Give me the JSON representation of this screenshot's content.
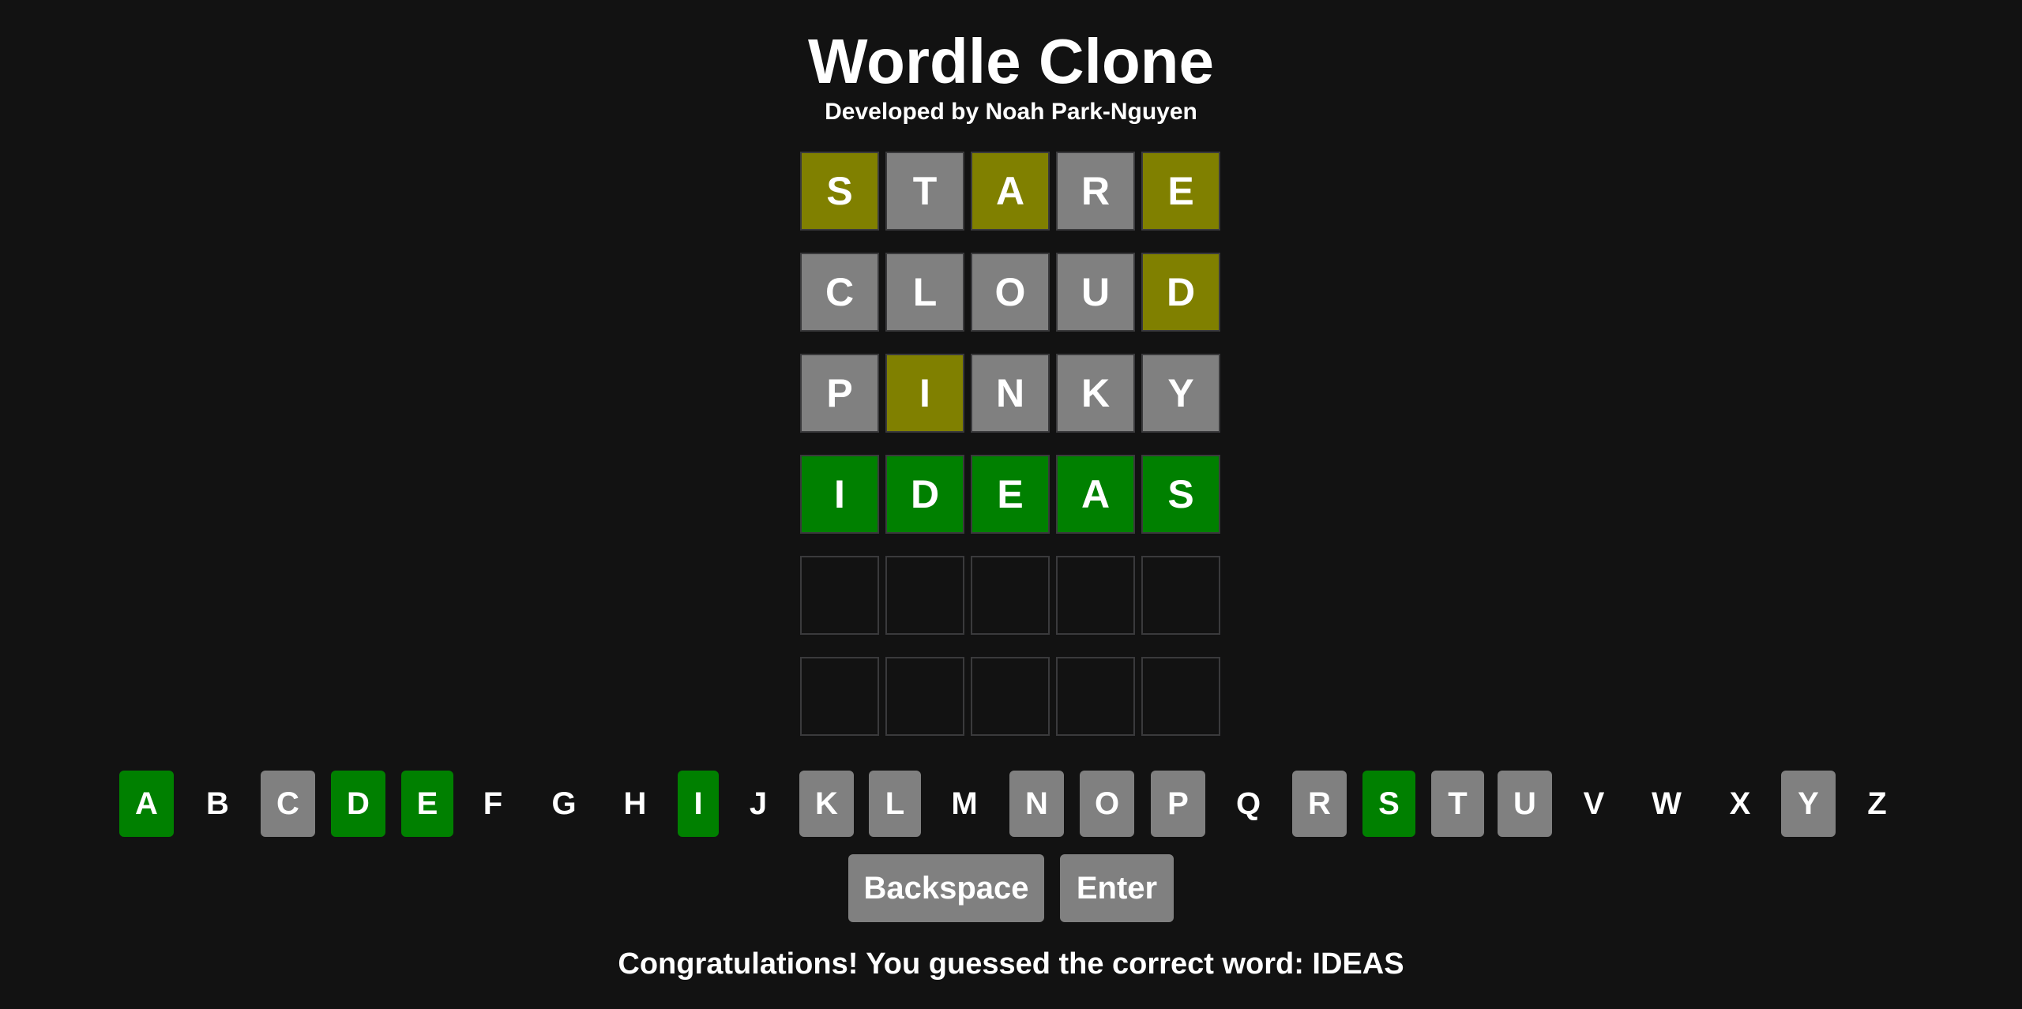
{
  "header": {
    "title": "Wordle Clone",
    "subtitle": "Developed by Noah Park-Nguyen"
  },
  "colors": {
    "background": "#121212",
    "correct": "#008000",
    "present": "#808000",
    "absent": "#808080",
    "empty_border": "#3a3a3c"
  },
  "board": {
    "rows": [
      [
        {
          "letter": "S",
          "state": "present"
        },
        {
          "letter": "T",
          "state": "absent"
        },
        {
          "letter": "A",
          "state": "present"
        },
        {
          "letter": "R",
          "state": "absent"
        },
        {
          "letter": "E",
          "state": "present"
        }
      ],
      [
        {
          "letter": "C",
          "state": "absent"
        },
        {
          "letter": "L",
          "state": "absent"
        },
        {
          "letter": "O",
          "state": "absent"
        },
        {
          "letter": "U",
          "state": "absent"
        },
        {
          "letter": "D",
          "state": "present"
        }
      ],
      [
        {
          "letter": "P",
          "state": "absent"
        },
        {
          "letter": "I",
          "state": "present"
        },
        {
          "letter": "N",
          "state": "absent"
        },
        {
          "letter": "K",
          "state": "absent"
        },
        {
          "letter": "Y",
          "state": "absent"
        }
      ],
      [
        {
          "letter": "I",
          "state": "correct"
        },
        {
          "letter": "D",
          "state": "correct"
        },
        {
          "letter": "E",
          "state": "correct"
        },
        {
          "letter": "A",
          "state": "correct"
        },
        {
          "letter": "S",
          "state": "correct"
        }
      ],
      [
        {
          "letter": "",
          "state": "empty"
        },
        {
          "letter": "",
          "state": "empty"
        },
        {
          "letter": "",
          "state": "empty"
        },
        {
          "letter": "",
          "state": "empty"
        },
        {
          "letter": "",
          "state": "empty"
        }
      ],
      [
        {
          "letter": "",
          "state": "empty"
        },
        {
          "letter": "",
          "state": "empty"
        },
        {
          "letter": "",
          "state": "empty"
        },
        {
          "letter": "",
          "state": "empty"
        },
        {
          "letter": "",
          "state": "empty"
        }
      ]
    ]
  },
  "keyboard": {
    "keys": [
      {
        "letter": "A",
        "state": "correct"
      },
      {
        "letter": "B",
        "state": "unused"
      },
      {
        "letter": "C",
        "state": "absent"
      },
      {
        "letter": "D",
        "state": "correct"
      },
      {
        "letter": "E",
        "state": "correct"
      },
      {
        "letter": "F",
        "state": "unused"
      },
      {
        "letter": "G",
        "state": "unused"
      },
      {
        "letter": "H",
        "state": "unused"
      },
      {
        "letter": "I",
        "state": "correct"
      },
      {
        "letter": "J",
        "state": "unused"
      },
      {
        "letter": "K",
        "state": "absent"
      },
      {
        "letter": "L",
        "state": "absent"
      },
      {
        "letter": "M",
        "state": "unused"
      },
      {
        "letter": "N",
        "state": "absent"
      },
      {
        "letter": "O",
        "state": "absent"
      },
      {
        "letter": "P",
        "state": "absent"
      },
      {
        "letter": "Q",
        "state": "unused"
      },
      {
        "letter": "R",
        "state": "absent"
      },
      {
        "letter": "S",
        "state": "correct"
      },
      {
        "letter": "T",
        "state": "absent"
      },
      {
        "letter": "U",
        "state": "absent"
      },
      {
        "letter": "V",
        "state": "unused"
      },
      {
        "letter": "W",
        "state": "unused"
      },
      {
        "letter": "X",
        "state": "unused"
      },
      {
        "letter": "Y",
        "state": "absent"
      },
      {
        "letter": "Z",
        "state": "unused"
      }
    ],
    "backspace_label": "Backspace",
    "enter_label": "Enter"
  },
  "message": "Congratulations! You guessed the correct word: IDEAS"
}
